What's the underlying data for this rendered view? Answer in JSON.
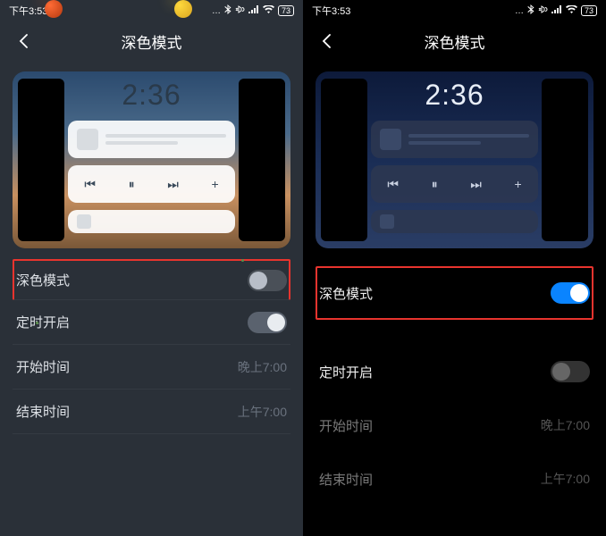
{
  "status": {
    "time": "下午3:53",
    "battery": "73"
  },
  "header": {
    "title": "深色模式"
  },
  "preview": {
    "clock": "2:36",
    "player": {
      "prev": "⏮",
      "pause": "⏸",
      "next": "⏭",
      "plus": "+"
    }
  },
  "left": {
    "rows": {
      "dark_mode": {
        "label": "深色模式",
        "state": "off"
      },
      "schedule": {
        "label": "定时开启",
        "state": "on"
      },
      "start": {
        "label": "开始时间",
        "value": "晚上7:00"
      },
      "end": {
        "label": "结束时间",
        "value": "上午7:00"
      }
    }
  },
  "right": {
    "rows": {
      "dark_mode": {
        "label": "深色模式",
        "state": "on"
      },
      "schedule": {
        "label": "定时开启",
        "state": "off"
      },
      "start": {
        "label": "开始时间",
        "value": "晚上7:00"
      },
      "end": {
        "label": "结束时间",
        "value": "上午7:00"
      }
    }
  }
}
